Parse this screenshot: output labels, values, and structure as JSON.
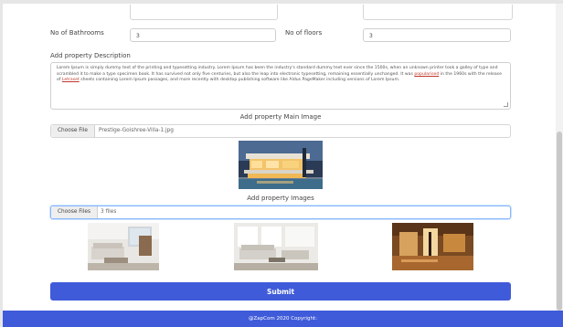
{
  "fields": {
    "bathrooms_label": "No of Bathrooms",
    "bathrooms_value": "3",
    "floors_label": "No of floors",
    "floors_value": "3"
  },
  "description": {
    "label": "Add property Description",
    "text_1": "Lorem Ipsum is simply dummy text of the printing and typesetting industry. Lorem Ipsum has been the industry's standard dummy text ever since the 1500s, when an unknown printer took a galley of type and scrambled it to make a type specimen book. It has survived not only five centuries, but also the leap into electronic typesetting, remaining essentially unchanged. It was ",
    "link_1": "popularised",
    "text_2": " in the 1960s with the release of ",
    "link_2": "Letraset",
    "text_3": " sheets containing Lorem Ipsum passages, and more recently with desktop publishing software like Aldus PageMaker including versions of Lorem Ipsum."
  },
  "main_image": {
    "label": "Add property Main Image",
    "button": "Choose File",
    "filename": "Prestige-Goishree-Villa-1.jpg"
  },
  "images": {
    "label": "Add property Images",
    "button": "Choose Files",
    "filename": "3 files"
  },
  "submit_label": "Submit",
  "footer_text": "@ZapCom 2020 Copyright:"
}
